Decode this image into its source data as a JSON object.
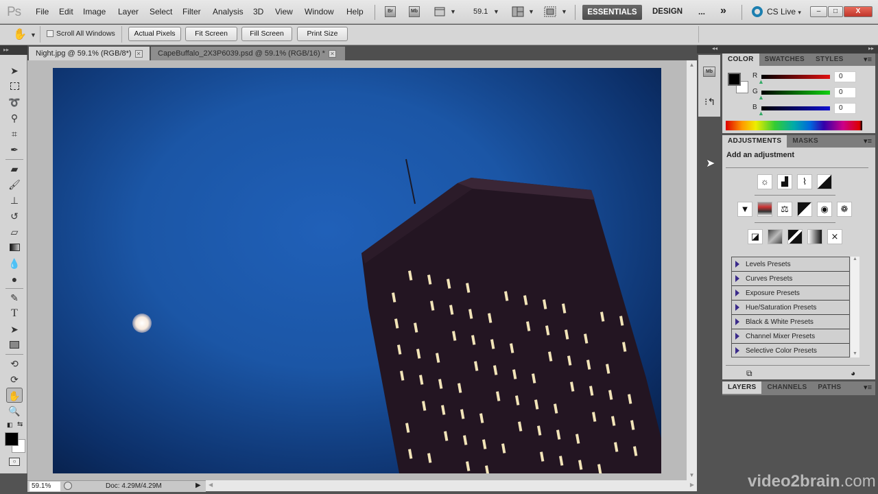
{
  "app": {
    "logo": "Ps"
  },
  "menu": [
    "File",
    "Edit",
    "Image",
    "Layer",
    "Select",
    "Filter",
    "Analysis",
    "3D",
    "View",
    "Window",
    "Help"
  ],
  "appbar": {
    "bridge_label": "Br",
    "minibridge_label": "Mb",
    "zoom_value": "59.1",
    "workspaces": {
      "active": "ESSENTIALS",
      "other": "DESIGN",
      "more": "...",
      "overflow": "»"
    },
    "cs_live": "CS Live"
  },
  "window_controls": {
    "minimize": "–",
    "restore": "□",
    "close": "X"
  },
  "options_bar": {
    "tool_icon": "hand-icon",
    "scroll_all_windows": {
      "label": "Scroll All Windows",
      "checked": false
    },
    "buttons": [
      "Actual Pixels",
      "Fit Screen",
      "Fill Screen",
      "Print Size"
    ]
  },
  "documents": [
    {
      "title": "Night.jpg @ 59.1% (RGB/8*)",
      "active": true
    },
    {
      "title": "CapeBuffalo_2X3P6039.psd @ 59.1% (RGB/16) *",
      "active": false
    }
  ],
  "tools": [
    "move",
    "rectangular-marquee",
    "lasso",
    "quick-selection",
    "crop",
    "eyedropper",
    "spot-healing-brush",
    "brush",
    "clone-stamp",
    "history-brush",
    "eraser",
    "gradient",
    "blur",
    "dodge",
    "pen",
    "type",
    "path-selection",
    "rectangle",
    "3d-rotate",
    "3d-orbit",
    "hand",
    "zoom"
  ],
  "tool_glyphs": {
    "type": "T"
  },
  "active_tool": "hand",
  "status": {
    "zoom": "59.1%",
    "doc": "Doc: 4.29M/4.29M"
  },
  "color_panel": {
    "tabs": [
      "COLOR",
      "SWATCHES",
      "STYLES"
    ],
    "active_tab": "COLOR",
    "foreground": "#000000",
    "background": "#ffffff",
    "channels": [
      {
        "label": "R",
        "value": "0",
        "color": "#e01010"
      },
      {
        "label": "G",
        "value": "0",
        "color": "#10d010"
      },
      {
        "label": "B",
        "value": "0",
        "color": "#1010d0"
      }
    ]
  },
  "adjustments_panel": {
    "tabs": [
      "ADJUSTMENTS",
      "MASKS"
    ],
    "active_tab": "ADJUSTMENTS",
    "heading": "Add an adjustment",
    "icon_rows": [
      [
        "brightness-contrast",
        "levels",
        "curves",
        "exposure"
      ],
      [
        "vibrance",
        "hue-saturation",
        "color-balance",
        "black-white",
        "photo-filter",
        "channel-mixer"
      ],
      [
        "invert",
        "posterize",
        "threshold",
        "gradient-map",
        "selective-color"
      ]
    ],
    "presets": [
      "Levels Presets",
      "Curves Presets",
      "Exposure Presets",
      "Hue/Saturation Presets",
      "Black & White Presets",
      "Channel Mixer Presets",
      "Selective Color Presets"
    ]
  },
  "layers_panel": {
    "tabs": [
      "LAYERS",
      "CHANNELS",
      "PATHS"
    ],
    "active_tab": "LAYERS"
  },
  "watermark": {
    "main": "video2brain",
    "suffix": ".com"
  }
}
